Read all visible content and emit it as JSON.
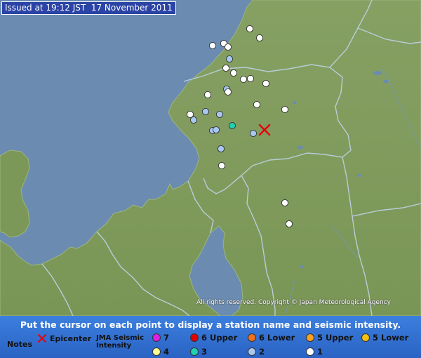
{
  "header": {
    "issued": "Issued at 19:12 JST  17 November 2011"
  },
  "map": {
    "copyright": "All rights reserved. Copyright © Japan Meteorological Agency",
    "colors": {
      "sea": "#6b8cb0",
      "land": "#7e9b5a",
      "station_1": "#ffffff",
      "station_2": "#a8c8f0",
      "station_3": "#20d0b0",
      "epicenter": "#e8000c"
    }
  },
  "legend": {
    "instruction": "Put the cursor on each point to display a station name and seismic intensity.",
    "notes": "Notes",
    "epicenter": "Epicenter",
    "jma_label": "JMA Seismic Intensity",
    "items": [
      {
        "label": "7",
        "color": "#e020e0"
      },
      {
        "label": "6 Upper",
        "color": "#e00000"
      },
      {
        "label": "6 Lower",
        "color": "#f07020"
      },
      {
        "label": "5 Upper",
        "color": "#f8a020"
      },
      {
        "label": "5 Lower",
        "color": "#f8c010"
      },
      {
        "label": "4",
        "color": "#ffff90"
      },
      {
        "label": "3",
        "color": "#20d0b0"
      },
      {
        "label": "2",
        "color": "#a8c8f0"
      },
      {
        "label": "1",
        "color": "#ffffff"
      }
    ]
  }
}
